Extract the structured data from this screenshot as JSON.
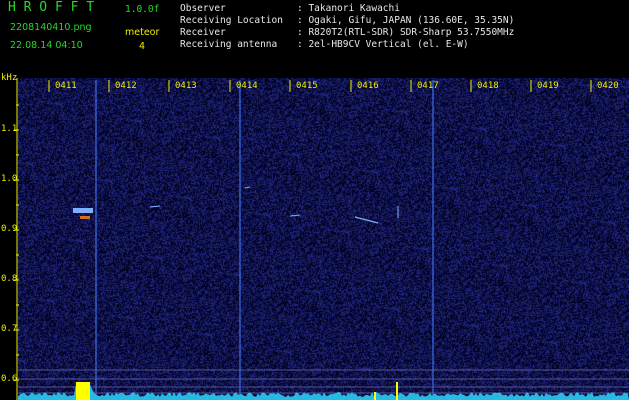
{
  "app": {
    "title": "H R O F F T",
    "version": "1.0.0f",
    "filename": "2208140410.png",
    "datetime": "22.08.14 04:10",
    "mode": "meteor",
    "count": "4"
  },
  "info": {
    "labels": [
      "Observer",
      "Receiving Location",
      "Receiver",
      "Receiving antenna"
    ],
    "values": [
      ": Takanori Kawachi",
      ": Ogaki, Gifu, JAPAN (136.60E, 35.35N)",
      ": R820T2(RTL-SDR) SDR-Sharp 53.7550MHz",
      ": 2el-HB9CV Vertical (el. E-W)"
    ]
  },
  "axis": {
    "unit": "kHz",
    "freq_ticks": [
      "1.1",
      "1.0",
      "0.9",
      "0.8",
      "0.7",
      "0.6"
    ],
    "time_ticks": [
      "0411",
      "0412",
      "0413",
      "0414",
      "0415",
      "0416",
      "0417",
      "0418",
      "0419",
      "0420"
    ]
  },
  "colors": {
    "background": "#000000",
    "noise": "#1a1f7a",
    "signal": "#7fb0ff",
    "label": "#f0f000",
    "title": "#28d828",
    "spectrum": "#2ad8ff",
    "peak": "#ffff00"
  }
}
